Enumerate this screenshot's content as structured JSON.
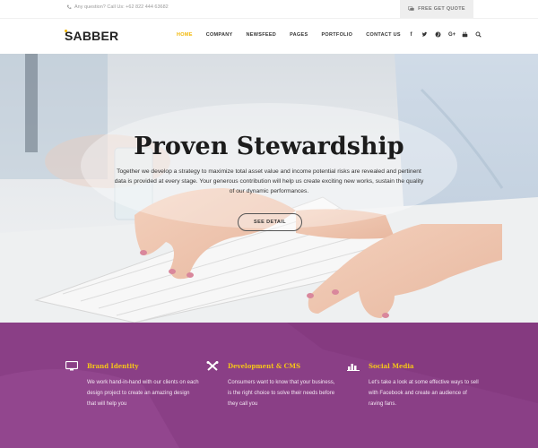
{
  "topbar": {
    "contact_text": "Any question? Call Us: +62 822 444 63682",
    "quote_label": "FREE GET QUOTE"
  },
  "header": {
    "logo": "SABBER",
    "nav": [
      "HOME",
      "COMPANY",
      "NEWSFEED",
      "PAGES",
      "PORTFOLIO",
      "CONTACT US"
    ],
    "active_nav": "HOME",
    "social_icons": [
      "facebook-icon",
      "twitter-icon",
      "pinterest-icon",
      "google-plus-icon",
      "youtube-icon",
      "search-icon"
    ],
    "accent_color": "#f2b705"
  },
  "hero": {
    "title": "Proven Stewardship",
    "text": "Together we develop a strategy to maximize total asset value and income  potential risks are revealed and pertinent data is provided at every stage. Your generous contribution will help us create exciting new works, sustain the quality of our dynamic performances.",
    "button_label": "SEE DETAIL"
  },
  "features": {
    "background_color": "#8a3f86",
    "title_color": "#f5c518",
    "items": [
      {
        "icon": "monitor-icon",
        "title": "Brand Identity",
        "text": "We work hand-in-hand with our clients on each design project to create an amazing design that will help you"
      },
      {
        "icon": "tools-icon",
        "title": "Development & CMS",
        "text": "Consumers want to know that your business, is the right choice to solve their needs before they call you"
      },
      {
        "icon": "chart-icon",
        "title": "Social Media",
        "text": "Let's take a look at some effective ways to sell with Facebook and create an audience of raving fans."
      }
    ]
  }
}
